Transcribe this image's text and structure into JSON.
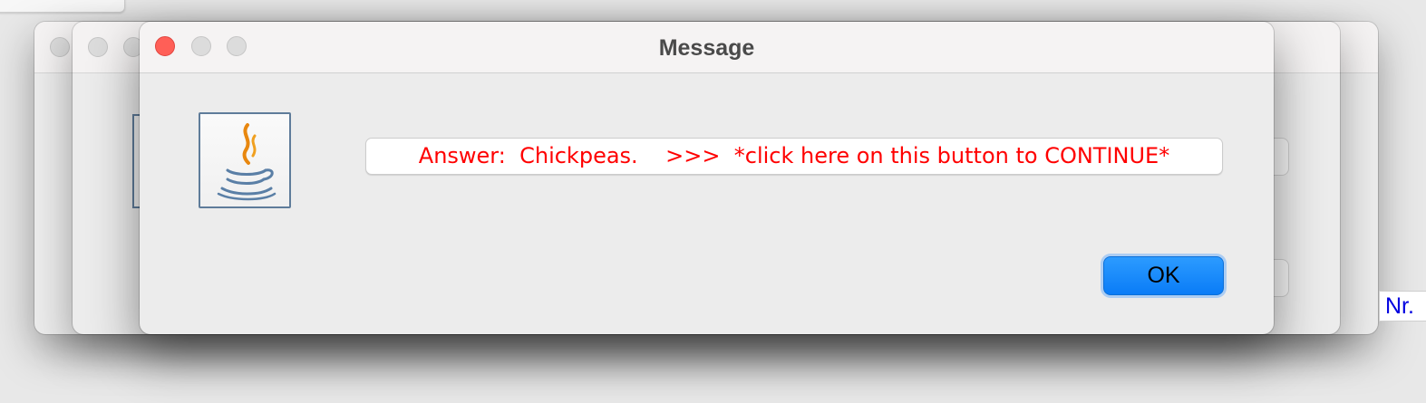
{
  "background_windows": [
    {
      "name": "back-window-1"
    },
    {
      "name": "back-window-2"
    }
  ],
  "dialog": {
    "title": "Message",
    "icon": "java-coffee-cup-icon",
    "message_button_label": "Answer:  Chickpeas.    >>>  *click here on this button to CONTINUE*",
    "ok_label": "OK",
    "colors": {
      "message_text": "#ff0000",
      "ok_button": "#0a7cf7",
      "close_button": "#ff5f57"
    }
  },
  "background_label": {
    "text": "Nr."
  }
}
